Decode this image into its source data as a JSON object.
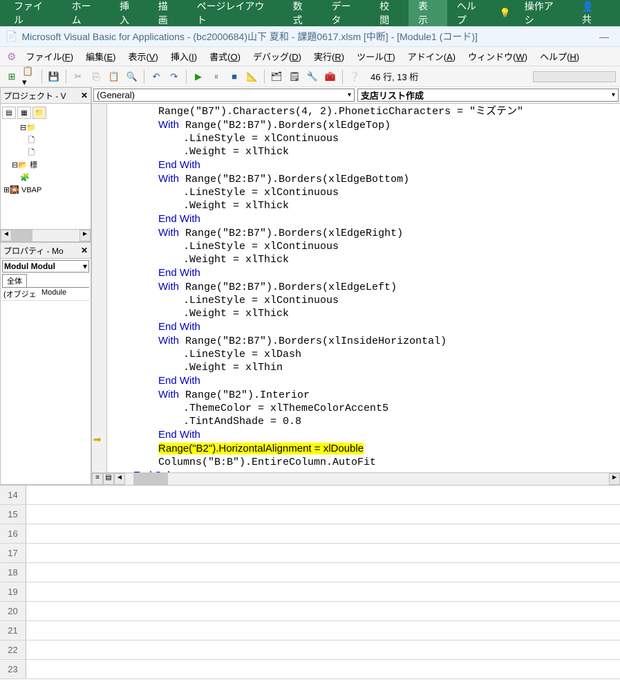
{
  "ribbon": {
    "tabs": [
      "ファイル",
      "ホーム",
      "挿入",
      "描画",
      "ページレイアウト",
      "数式",
      "データ",
      "校閲",
      "表示",
      "ヘルプ"
    ],
    "active": "表示",
    "assist": "操作アシ",
    "share": "共"
  },
  "vbe": {
    "title": "Microsoft Visual Basic for Applications - (bc2000684)山下 夏和 - 課題0617.xlsm [中断] - [Module1 (コード)]",
    "menu": {
      "file": "ファイル(F)",
      "edit": "編集(E)",
      "view": "表示(V)",
      "insert": "挿入(I)",
      "format": "書式(O)",
      "debug": "デバッグ(D)",
      "run": "実行(R)",
      "tools": "ツール(T)",
      "addins": "アドイン(A)",
      "window": "ウィンドウ(W)",
      "help": "ヘルプ(H)"
    },
    "position": "46 行, 13 桁",
    "project_title": "プロジェクト - V",
    "tree": {
      "vbap": "VBAP",
      "std": "標"
    },
    "props_title": "プロパティ - Mo",
    "props_sel": "Modul Modul",
    "props_tab": "全体",
    "props_row_k": "(オブジェ",
    "props_row_v": "Module",
    "dd_left": "(General)",
    "dd_right": "支店リスト作成",
    "code_lines": [
      {
        "i": 0,
        "t": "        Range(\"B7\").Characters(4, 2).PhoneticCharacters = \"ミズテン\""
      },
      {
        "i": 0,
        "pre": "        ",
        "kw": "With",
        "t": " Range(\"B2:B7\").Borders(xlEdgeTop)"
      },
      {
        "i": 0,
        "t": "            .LineStyle = xlContinuous"
      },
      {
        "i": 0,
        "t": "            .Weight = xlThick"
      },
      {
        "i": 0,
        "pre": "        ",
        "kw": "End With"
      },
      {
        "i": 0,
        "pre": "        ",
        "kw": "With",
        "t": " Range(\"B2:B7\").Borders(xlEdgeBottom)"
      },
      {
        "i": 0,
        "t": "            .LineStyle = xlContinuous"
      },
      {
        "i": 0,
        "t": "            .Weight = xlThick"
      },
      {
        "i": 0,
        "pre": "        ",
        "kw": "End With"
      },
      {
        "i": 0,
        "pre": "        ",
        "kw": "With",
        "t": " Range(\"B2:B7\").Borders(xlEdgeRight)"
      },
      {
        "i": 0,
        "t": "            .LineStyle = xlContinuous"
      },
      {
        "i": 0,
        "t": "            .Weight = xlThick"
      },
      {
        "i": 0,
        "pre": "        ",
        "kw": "End With"
      },
      {
        "i": 0,
        "pre": "        ",
        "kw": "With",
        "t": " Range(\"B2:B7\").Borders(xlEdgeLeft)"
      },
      {
        "i": 0,
        "t": "            .LineStyle = xlContinuous"
      },
      {
        "i": 0,
        "t": "            .Weight = xlThick"
      },
      {
        "i": 0,
        "pre": "        ",
        "kw": "End With"
      },
      {
        "i": 0,
        "pre": "        ",
        "kw": "With",
        "t": " Range(\"B2:B7\").Borders(xlInsideHorizontal)"
      },
      {
        "i": 0,
        "t": "            .LineStyle = xlDash"
      },
      {
        "i": 0,
        "t": "            .Weight = xlThin"
      },
      {
        "i": 0,
        "pre": "        ",
        "kw": "End With"
      },
      {
        "i": 0,
        "pre": "        ",
        "kw": "With",
        "t": " Range(\"B2\").Interior"
      },
      {
        "i": 0,
        "t": "            .ThemeColor = xlThemeColorAccent5"
      },
      {
        "i": 0,
        "t": "            .TintAndShade = 0.8"
      },
      {
        "i": 0,
        "pre": "        ",
        "kw": "End With"
      },
      {
        "i": 0,
        "hl": 1,
        "t": "        Range(\"B2\").HorizontalAlignment = xlDouble"
      },
      {
        "i": 0,
        "t": "        Columns(\"B:B\").EntireColumn.AutoFit"
      },
      {
        "i": 0,
        "pre": "    ",
        "kw": "End Sub"
      }
    ],
    "arrow_line": 25
  },
  "grid_rows": [
    14,
    15,
    16,
    17,
    18,
    19,
    20,
    21,
    22,
    23
  ]
}
